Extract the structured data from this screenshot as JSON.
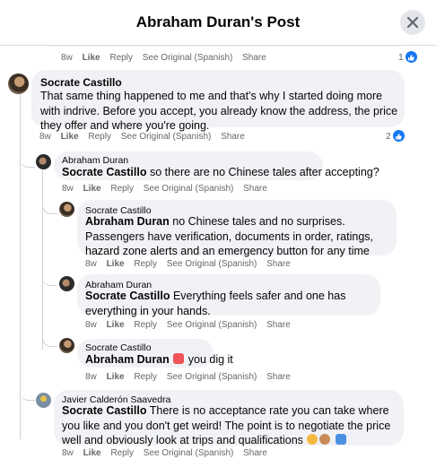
{
  "header": {
    "title": "Abraham Duran's Post"
  },
  "actions": {
    "like": "Like",
    "reply": "Reply",
    "see_original": "See Original (Spanish)",
    "share": "Share"
  },
  "comments": [
    {
      "time": "8w",
      "reactions": "1"
    },
    {
      "author": "Socrate Castillo",
      "text": "That same thing happened to me and that's why I started doing more with indrive. Before you accept, you already know the address, the price they offer and where you're going.",
      "time": "8w",
      "reactions": "2"
    },
    {
      "author": "Abraham Duran",
      "tag": "Socrate Castillo",
      "text": " so there are no Chinese tales after accepting?",
      "time": "8w"
    },
    {
      "author": "Socrate Castillo",
      "tag": "Abraham Duran",
      "text": " no Chinese tales and no surprises. Passengers have verification, documents in order, ratings, hazard zone alerts and an emergency button for any time",
      "time": "8w"
    },
    {
      "author": "Abraham Duran",
      "tag": "Socrate Castillo",
      "text": " Everything feels safer and one has everything in your hands.",
      "time": "8w"
    },
    {
      "author": "Socrate Castillo",
      "tag": "Abraham Duran",
      "text": " you dig it",
      "time": "8w"
    },
    {
      "author": "Javier Calderón Saavedra",
      "tag": "Socrate Castillo",
      "text": " There is no acceptance rate you can take where you like and you don't get weird! The point is to negotiate the price well and obviously look at trips and qualifications",
      "time": "8w"
    }
  ],
  "colors": {
    "like_blue": "#1877f2",
    "bubble": "#f0f2f5",
    "secondary_text": "#65676b"
  }
}
